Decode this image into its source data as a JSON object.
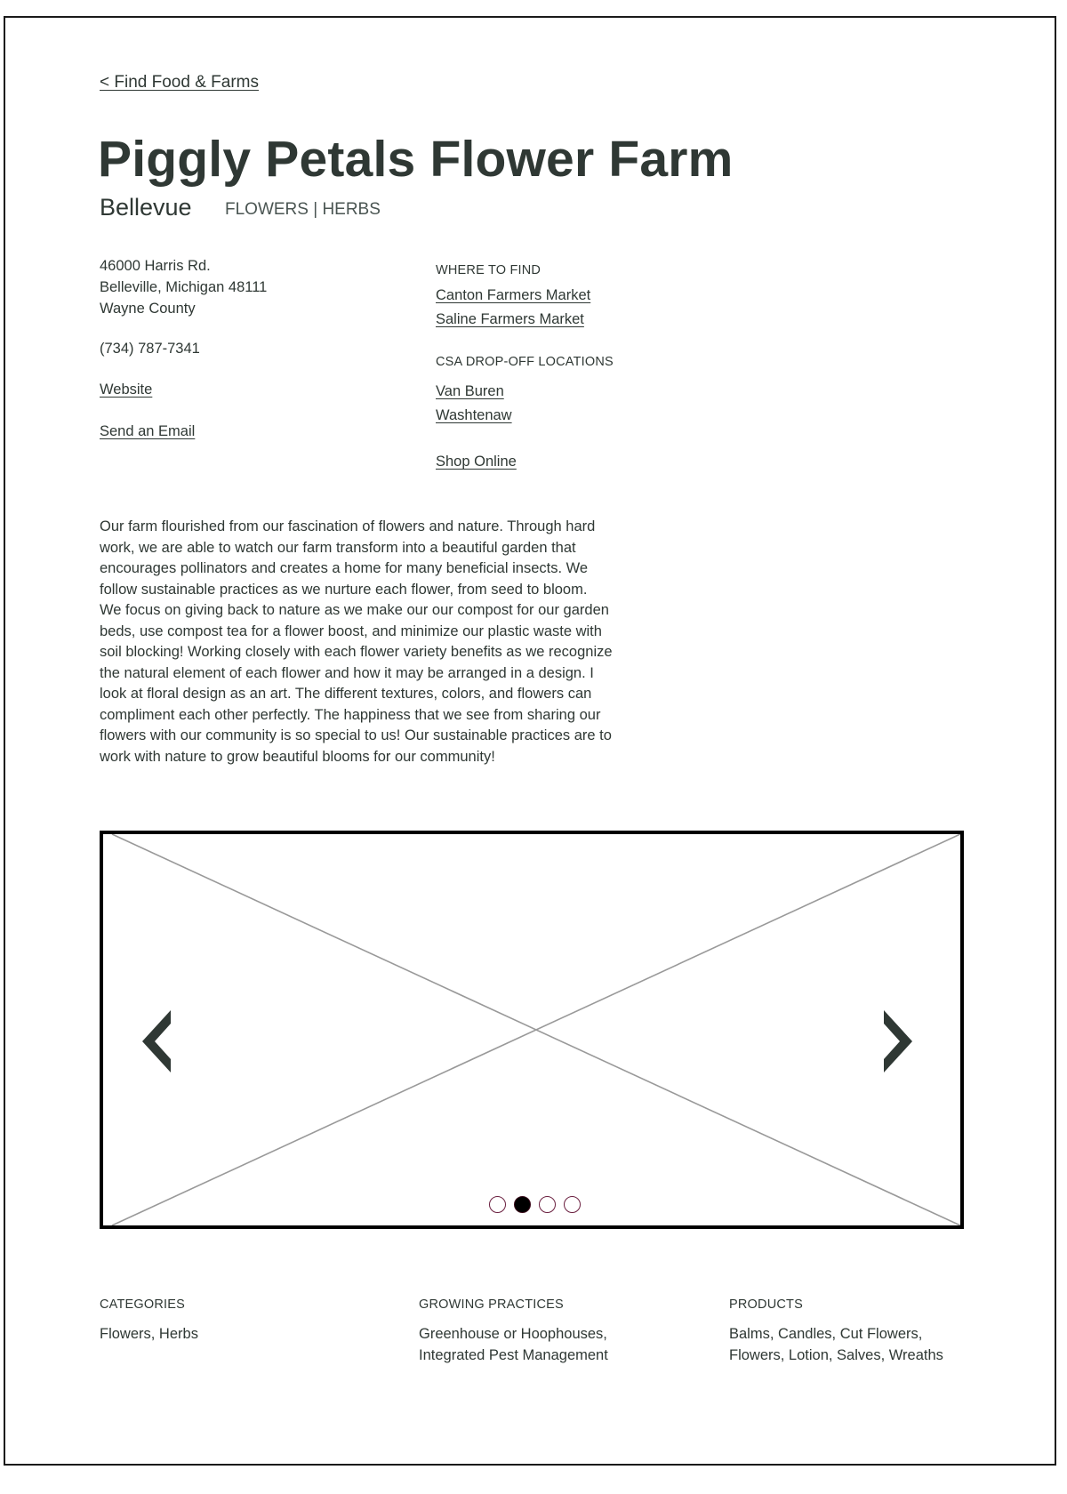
{
  "nav": {
    "back_link": "< Find Food & Farms"
  },
  "farm": {
    "name": "Piggly Petals Flower Farm",
    "city": "Bellevue",
    "tags": "FLOWERS | HERBS"
  },
  "contact": {
    "address_line1": "46000 Harris Rd.",
    "address_line2": "Belleville, Michigan 48111",
    "county": "Wayne County",
    "phone": "(734) 787-7341",
    "website_label": "Website",
    "email_label": "Send an Email"
  },
  "where_to_find": {
    "label": "WHERE TO FIND",
    "markets": [
      "Canton Farmers Market",
      "Saline Farmers Market"
    ]
  },
  "csa": {
    "label": "CSA DROP-OFF LOCATIONS",
    "locations": [
      "Van Buren",
      "Washtenaw"
    ]
  },
  "shop_online_label": "Shop Online",
  "description": "Our farm flourished from our fascination of flowers and nature. Through hard\nwork, we are able to watch our farm transform into a beautiful garden that\nencourages pollinators and creates a home for many beneficial insects.  We\nfollow sustainable practices as we nurture each flower, from seed to bloom.\nWe focus on giving back to nature as we make our our compost for our garden\nbeds, use compost tea for a flower boost, and minimize our plastic waste with\nsoil blocking! Working closely with each flower variety benefits as we recognize\nthe natural element of each flower and how it may be arranged in a design. I\nlook at floral design as an art. The different textures, colors, and flowers can\ncompliment each other perfectly. The happiness that we see from sharing our\nflowers with our community is so special to us! Our sustainable practices are to\nwork with nature to grow beautiful blooms for our community!",
  "carousel": {
    "slide_count": 4,
    "active_index": 1,
    "prev_icon": "chevron-left-icon",
    "next_icon": "chevron-right-icon",
    "dot_color": "#6b2040",
    "active_dot_color": "#000000"
  },
  "details": [
    {
      "label": "CATEGORIES",
      "lines": [
        "Flowers, Herbs"
      ]
    },
    {
      "label": "GROWING PRACTICES",
      "lines": [
        "Greenhouse or Hoophouses,",
        "Integrated Pest Management"
      ]
    },
    {
      "label": "PRODUCTS",
      "lines": [
        "Balms, Candles, Cut Flowers,",
        "Flowers, Lotion, Salves, Wreaths"
      ]
    }
  ],
  "colors": {
    "text": "#2f3834",
    "muted": "#4a5552"
  }
}
